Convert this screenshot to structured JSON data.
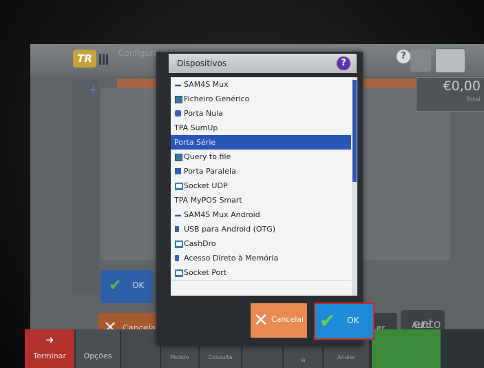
{
  "background_app": {
    "logo": "TR",
    "title": "Configuração",
    "total_amount": "€0,00",
    "total_label": "Total",
    "ok_label": "OK",
    "cancel_label": "Cancelar",
    "side_button_label": "er",
    "auto_label": "Auto",
    "bottom_bar": {
      "terminar_label": "Terminar",
      "opcoes_label": "Opções",
      "pedido_label": "Pedido",
      "consulta_label": "Consulta",
      "ia_label": "ia",
      "anular_label": "Anular",
      "right_text": "ento"
    }
  },
  "dialog": {
    "title": "Dispositivos",
    "help_symbol": "?",
    "devices": [
      {
        "label": "SAM4S Mux",
        "icon": "network-icon"
      },
      {
        "label": "Ficheiro Genérico",
        "icon": "file-icon"
      },
      {
        "label": "Porta Nula",
        "icon": "null-port-icon"
      },
      {
        "label": "TPA SumUp",
        "icon": ""
      },
      {
        "label": "Porta Série",
        "icon": "",
        "selected": true
      },
      {
        "label": "Query to file",
        "icon": "file-icon"
      },
      {
        "label": "Porta Paralela",
        "icon": "parallel-port-icon"
      },
      {
        "label": "Socket UDP",
        "icon": "monitor-icon"
      },
      {
        "label": "TPA MyPOS Smart",
        "icon": ""
      },
      {
        "label": "SAM4S Mux Android",
        "icon": "network-icon"
      },
      {
        "label": "USB para Android (OTG)",
        "icon": "usb-icon"
      },
      {
        "label": "CashDro",
        "icon": "monitor-icon"
      },
      {
        "label": "Acesso Direto à Memória",
        "icon": "usb-icon"
      },
      {
        "label": "Socket Port",
        "icon": "monitor-icon"
      }
    ],
    "cancel_label": "Cancelar",
    "ok_label": "OK"
  }
}
